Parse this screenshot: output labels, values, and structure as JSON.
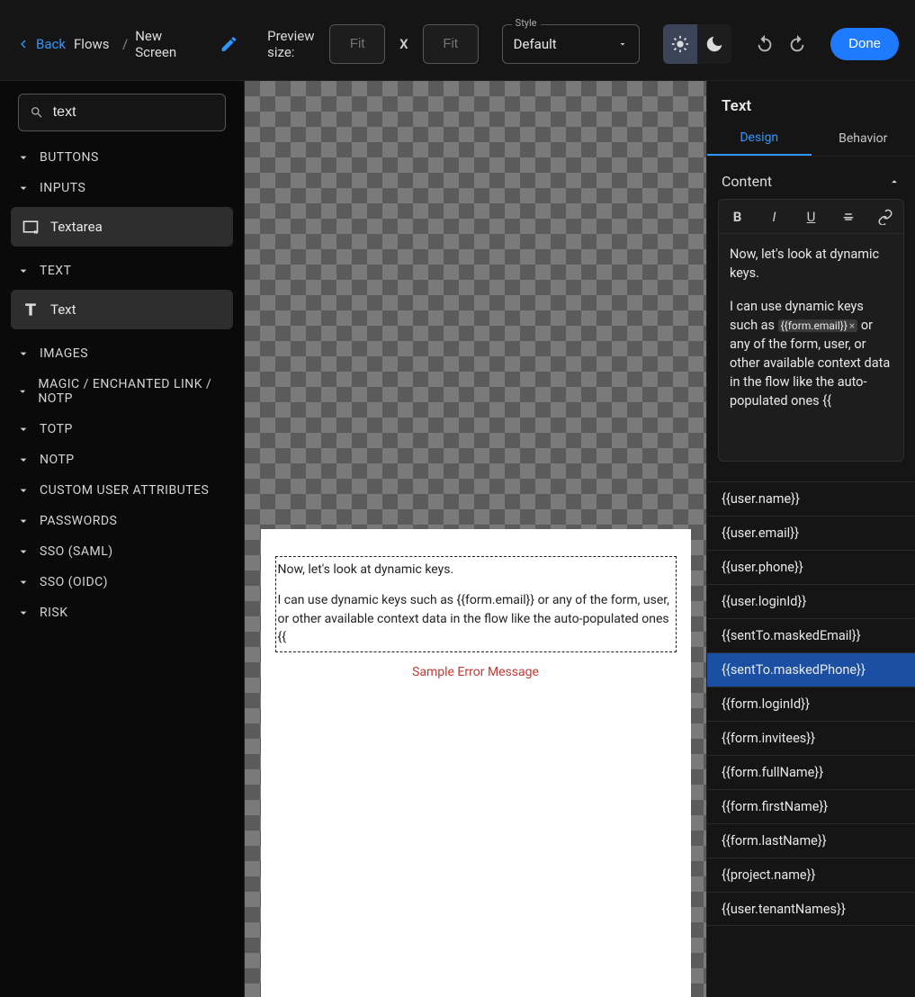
{
  "topbar": {
    "back": "Back",
    "crumb_flows": "Flows",
    "crumb_screen": "New Screen",
    "preview_label": "Preview size:",
    "width_placeholder": "Fit",
    "height_placeholder": "Fit",
    "size_sep": "X",
    "style_legend": "Style",
    "style_value": "Default",
    "done": "Done"
  },
  "sidebar": {
    "search_value": "text",
    "categories": {
      "buttons": "BUTTONS",
      "inputs": "INPUTS",
      "text": "TEXT",
      "images": "IMAGES",
      "magic": "MAGIC / ENCHANTED LINK / NOTP",
      "totp": "TOTP",
      "notp": "NOTP",
      "cua": "CUSTOM USER ATTRIBUTES",
      "passwords": "PASSWORDS",
      "sso_saml": "SSO (SAML)",
      "sso_oidc": "SSO (OIDC)",
      "risk": "RISK"
    },
    "items": {
      "textarea": "Textarea",
      "text": "Text"
    }
  },
  "canvas": {
    "para1": "Now, let's look at dynamic keys.",
    "para2": "I can use dynamic keys such as {{form.email}} or any of the form, user, or other available context data in the flow like the auto-populated ones {{",
    "error": "Sample Error Message"
  },
  "right": {
    "title": "Text",
    "tabs": {
      "design": "Design",
      "behavior": "Behavior"
    },
    "section": "Content",
    "editor": {
      "line1": "Now, let's look at dynamic keys.",
      "line2a": "I can use dynamic keys such as ",
      "chip": "{{form.email}}",
      "line2b": " or any of the form, user, or other available context data in the flow like the auto-populated ones {{"
    },
    "keys": [
      "{{user.name}}",
      "{{user.email}}",
      "{{user.phone}}",
      "{{user.loginId}}",
      "{{sentTo.maskedEmail}}",
      "{{sentTo.maskedPhone}}",
      "{{form.loginId}}",
      "{{form.invitees}}",
      "{{form.fullName}}",
      "{{form.firstName}}",
      "{{form.lastName}}",
      "{{project.name}}",
      "{{user.tenantNames}}"
    ],
    "selected_key_index": 5
  }
}
